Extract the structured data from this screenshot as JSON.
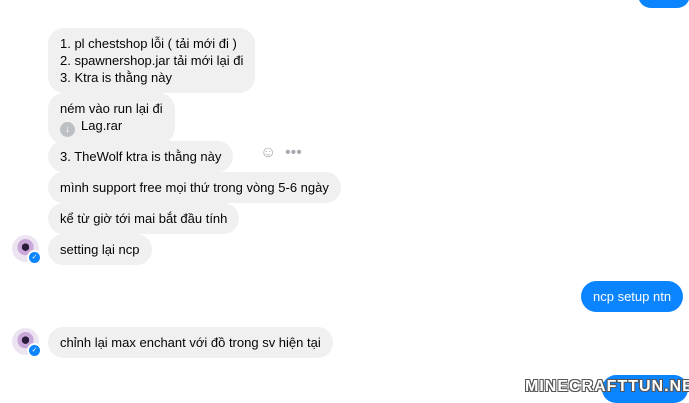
{
  "messages": {
    "m1": {
      "line1": "1. pl chestshop lỗi ( tải mới đi )",
      "line2": "2. spawnershop.jar tải mới lại đi",
      "line3": "3. Ktra is thằng này"
    },
    "m2": {
      "line1": "ném vào run lại đi",
      "attachment": "Lag.rar"
    },
    "m3": "3. TheWolf ktra is thằng này",
    "m4": "mình support free mọi thứ trong vòng 5-6 ngày",
    "m5": "kể từ giờ tới mai bắt đầu tính",
    "m6": "setting lại ncp",
    "sent1": "ncp setup ntn",
    "m7": "chỉnh lại max enchant với đồ trong sv hiện tại"
  },
  "icons": {
    "emoji": "smile-icon",
    "more": "more-icon",
    "attachment": "download-icon"
  },
  "colors": {
    "sent_bubble": "#0b84ff",
    "received_bubble": "#f0f0f0"
  },
  "watermark": "MINECRAFTTUN.NET"
}
